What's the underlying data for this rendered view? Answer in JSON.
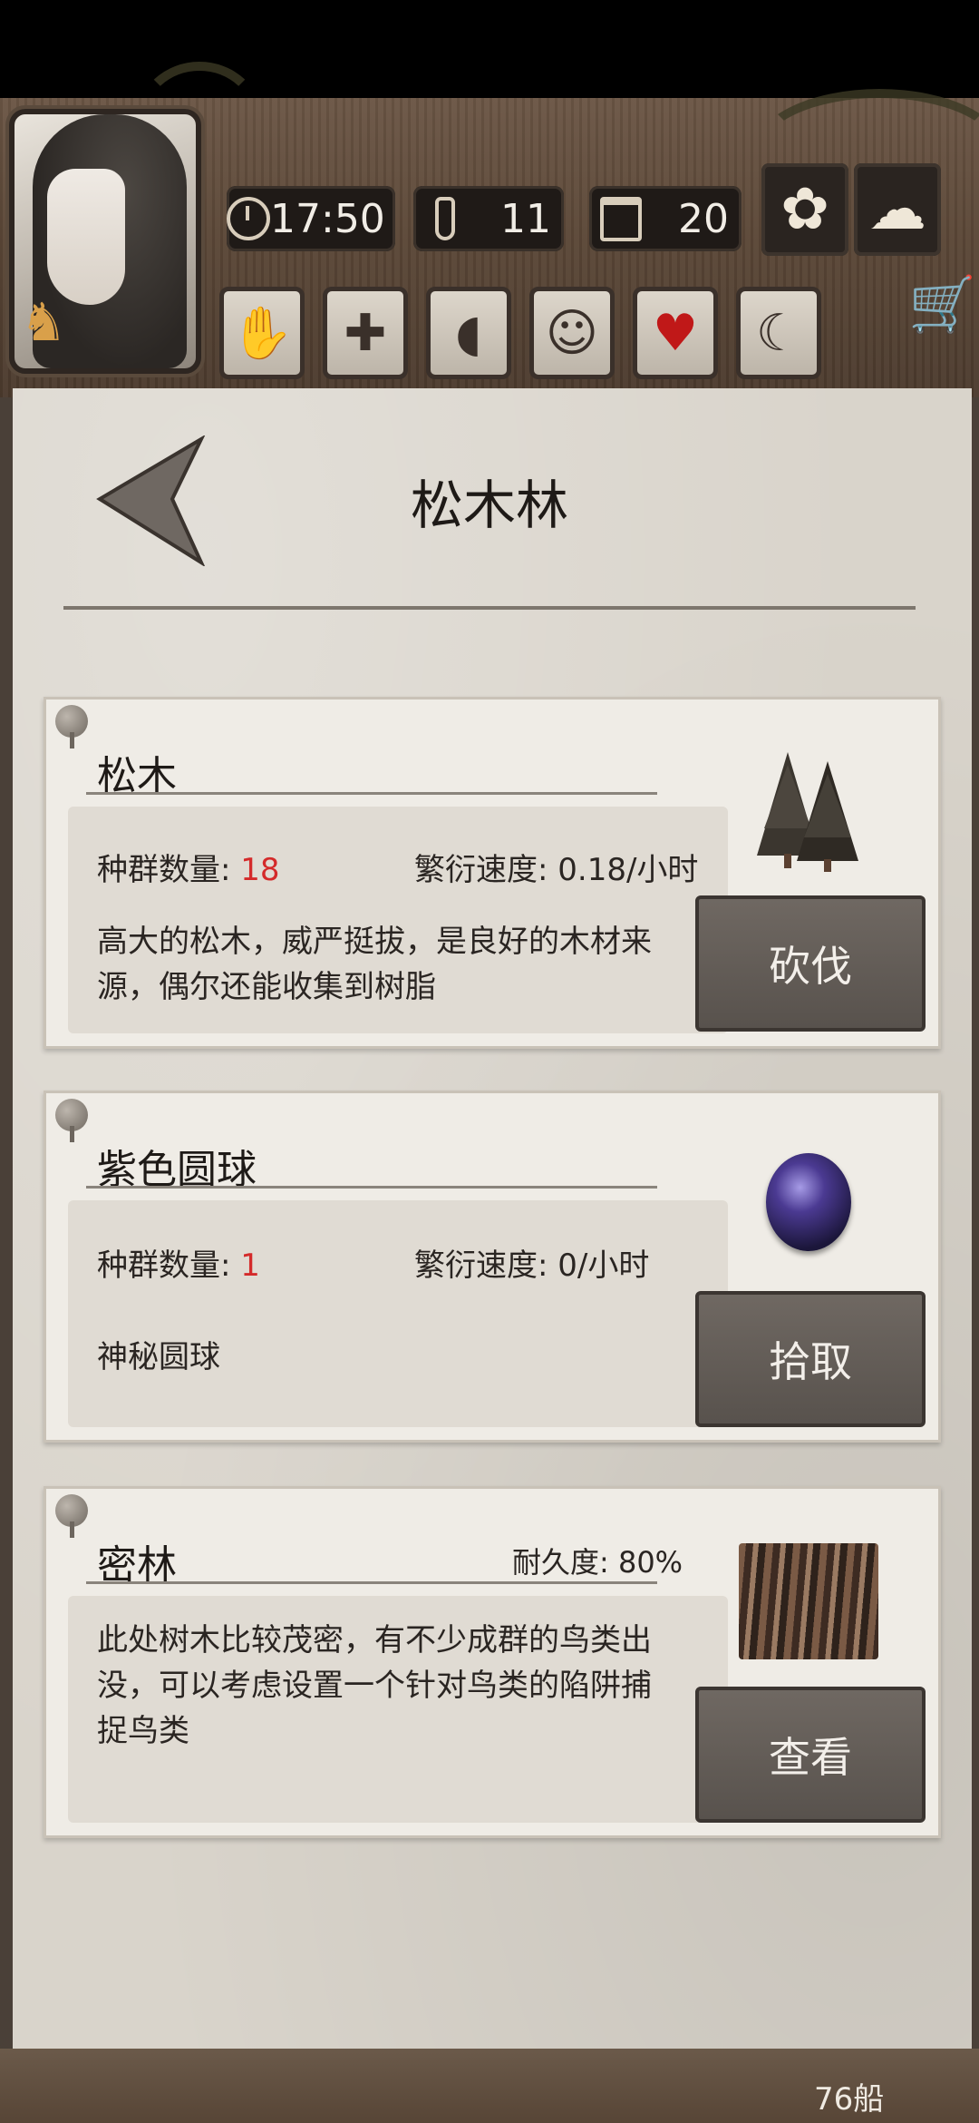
{
  "header": {
    "time": "17:50",
    "temperature": "11",
    "day": "20",
    "clock_icon": "clock-icon",
    "thermometer_icon": "thermometer-icon",
    "calendar_icon": "calendar-icon",
    "season_icon": "leaf-icon",
    "weather_icon": "cloud-icon",
    "status_icons": [
      "bandage-hand-icon",
      "medical-cross-icon",
      "stomach-icon",
      "head-icon",
      "heart-icon",
      "moon-icon"
    ],
    "shop_icon": "shopping-cart-icon"
  },
  "page": {
    "title": "松木林"
  },
  "resources": [
    {
      "name": "松木",
      "population_label": "种群数量: ",
      "population_value": "18",
      "growth_label": "繁衍速度: 0.18/小时",
      "description": "高大的松木，威严挺拔，是良好的木材来源，偶尔还能收集到树脂",
      "action": "砍伐",
      "icon": "pine-trees-icon"
    },
    {
      "name": "紫色圆球",
      "population_label": "种群数量: ",
      "population_value": "1",
      "growth_label": "繁衍速度: 0/小时",
      "description": "神秘圆球",
      "action": "拾取",
      "icon": "purple-orb-icon"
    },
    {
      "name": "密林",
      "durability": "耐久度: 80%",
      "description": "此处树木比较茂密，有不少成群的鸟类出没，可以考虑设置一个针对鸟类的陷阱捕捉鸟类",
      "action": "查看",
      "icon": "thicket-icon"
    }
  ],
  "footer": {
    "fragment": "76船"
  }
}
